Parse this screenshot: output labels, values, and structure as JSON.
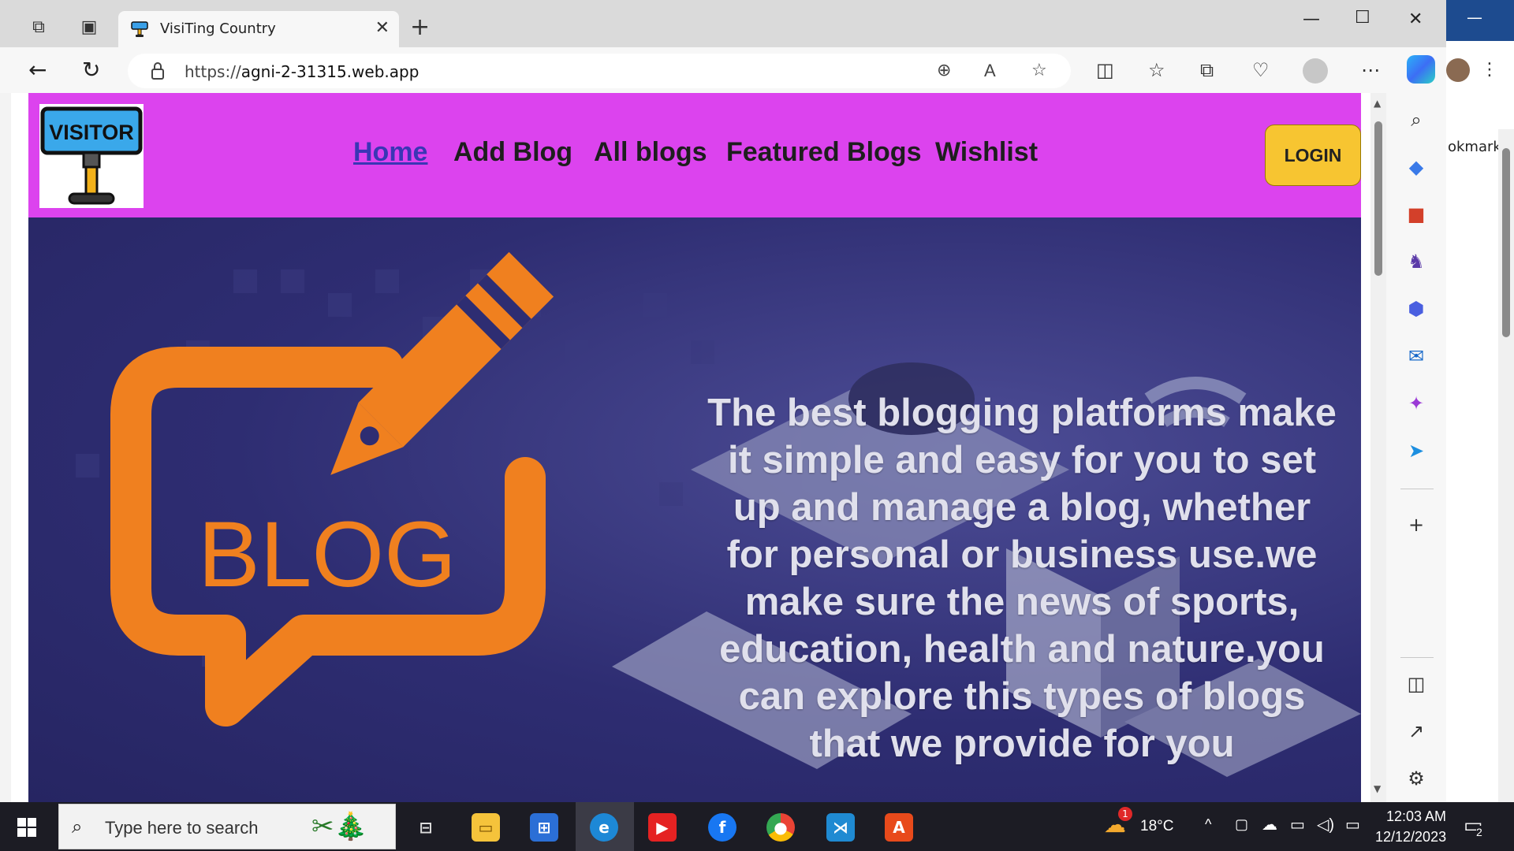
{
  "browser": {
    "tab_title": "VisiTing Country",
    "url_prefix": "https://",
    "url_host": "agni-2-31315.web.app"
  },
  "site": {
    "logo_text": "VISITOR",
    "nav": [
      {
        "label": "Home",
        "active": true
      },
      {
        "label": "Add Blog",
        "active": false
      },
      {
        "label": "All blogs",
        "active": false
      },
      {
        "label": "Featured Blogs",
        "active": false
      },
      {
        "label": "Wishlist",
        "active": false
      }
    ],
    "login_label": "LOGIN",
    "hero_image_text": "BLOG",
    "hero_text": "The best blogging platforms make it simple and easy for you to set up and manage a blog, whether for personal or business use.we make sure the news of sports, education, health and nature.you can explore this types of blogs that we provide for you"
  },
  "behind_window": {
    "partial_label": "okmarks"
  },
  "taskbar": {
    "search_placeholder": "Type here to search",
    "weather": "18°C",
    "weather_badge": "1",
    "time": "12:03 AM",
    "date": "12/12/2023",
    "notification_count": "2"
  },
  "colors": {
    "header_bg": "#dc43ee",
    "login_bg": "#f7c531",
    "active_nav": "#3a36b5",
    "blog_orange": "#f0801f"
  }
}
